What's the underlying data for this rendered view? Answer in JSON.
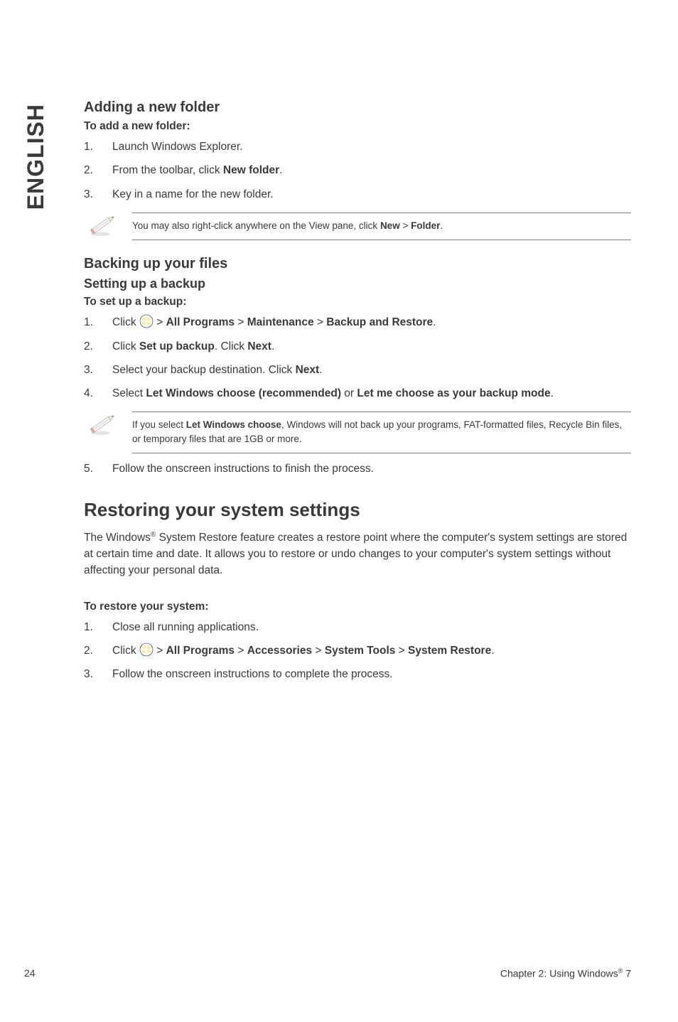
{
  "side_tab": "ENGLISH",
  "sec1": {
    "title": "Adding a new folder",
    "sub": "To add a new folder:",
    "steps": [
      "Launch Windows Explorer.",
      {
        "pre": "From the toolbar, click ",
        "b1": "New folder",
        "post": "."
      },
      "Key in a name for the new folder."
    ],
    "note": {
      "pre": "You may also right-click anywhere on the View pane, click ",
      "b1": "New",
      "mid": " > ",
      "b2": "Folder",
      "post": "."
    }
  },
  "sec2": {
    "title": "Backing up your files",
    "sub1": "Setting up a backup",
    "sub2": "To set up a backup:",
    "steps": [
      {
        "pre": "Click ",
        "icon": true,
        "mid": " > ",
        "b1": "All Programs",
        "mid2": " > ",
        "b2": "Maintenance",
        "mid3": " > ",
        "b3": "Backup and Restore",
        "post": "."
      },
      {
        "pre": "Click ",
        "b1": "Set up backup",
        "mid": ". Click ",
        "b2": "Next",
        "post": "."
      },
      {
        "pre": "Select your backup destination. Click ",
        "b1": "Next",
        "post": "."
      },
      {
        "pre": "Select ",
        "b1": "Let Windows choose (recommended)",
        "mid": " or ",
        "b2": "Let me choose as your backup mode",
        "post": "."
      }
    ],
    "note": {
      "pre": "If you select ",
      "b1": "Let Windows choose",
      "post": ", Windows will not back up your programs, FAT-formatted files, Recycle Bin files, or temporary files that are 1GB or more."
    },
    "step5": "Follow the onscreen instructions to finish the process."
  },
  "sec3": {
    "title": "Restoring your system settings",
    "para_pre": "The Windows",
    "para_sup": "®",
    "para_post": " System Restore feature creates a restore point where the computer's system settings are stored at certain time and date. It allows you to restore or undo changes to your computer's system settings without affecting your personal data.",
    "sub": "To restore your system:",
    "steps": [
      "Close all running applications.",
      {
        "pre": "Click ",
        "icon": true,
        "mid": " > ",
        "b1": "All Programs",
        "mid2": " > ",
        "b2": "Accessories",
        "mid3": " > ",
        "b3": "System Tools",
        "mid4": " > ",
        "b4": "System Restore",
        "post": "."
      },
      "Follow the onscreen instructions to complete the process."
    ]
  },
  "footer": {
    "left": "24",
    "right_pre": "Chapter 2: Using Windows",
    "right_sup": "®",
    "right_post": " 7"
  }
}
